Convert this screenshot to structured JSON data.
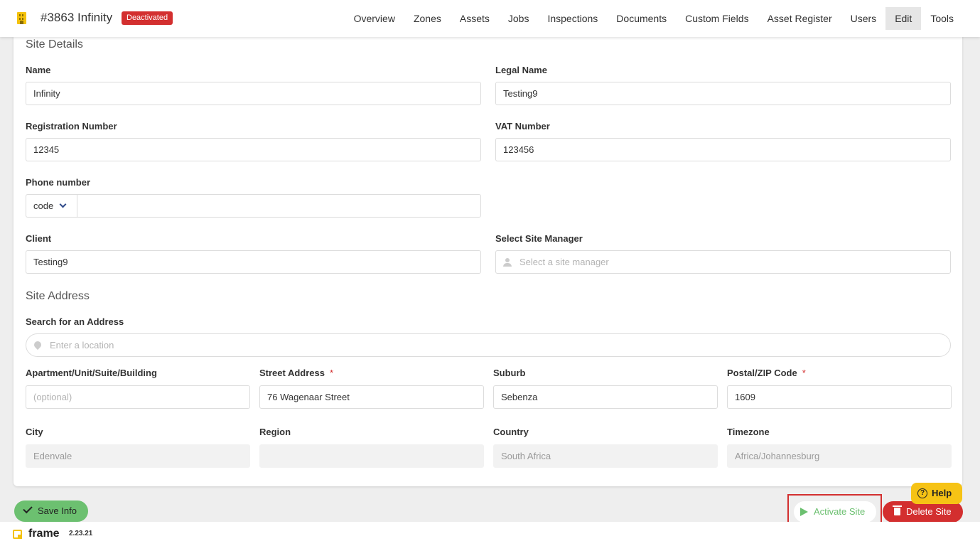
{
  "header": {
    "site_title": "#3863 Infinity",
    "status_badge": "Deactivated",
    "nav": [
      "Overview",
      "Zones",
      "Assets",
      "Jobs",
      "Inspections",
      "Documents",
      "Custom Fields",
      "Asset Register",
      "Users",
      "Edit",
      "Tools"
    ],
    "active_tab": "Edit"
  },
  "site_details": {
    "title": "Site Details",
    "name_label": "Name",
    "name_value": "Infinity",
    "legal_name_label": "Legal Name",
    "legal_name_value": "Testing9",
    "registration_label": "Registration Number",
    "registration_value": "12345",
    "vat_label": "VAT Number",
    "vat_value": "123456",
    "phone_label": "Phone number",
    "phone_code": "code",
    "phone_value": "",
    "client_label": "Client",
    "client_value": "Testing9",
    "manager_label": "Select Site Manager",
    "manager_placeholder": "Select a site manager"
  },
  "site_address": {
    "title": "Site Address",
    "search_label": "Search for an Address",
    "search_placeholder": "Enter a location",
    "apartment_label": "Apartment/Unit/Suite/Building",
    "apartment_placeholder": "(optional)",
    "street_label": "Street Address",
    "street_value": "76 Wagenaar Street",
    "suburb_label": "Suburb",
    "suburb_value": "Sebenza",
    "postal_label": "Postal/ZIP Code",
    "postal_value": "1609",
    "required_mark": "*",
    "city_label": "City",
    "city_value": "Edenvale",
    "region_label": "Region",
    "region_value": "",
    "country_label": "Country",
    "country_value": "South Africa",
    "timezone_label": "Timezone",
    "timezone_value": "Africa/Johannesburg"
  },
  "actions": {
    "save": "Save Info",
    "help": "Help",
    "help_glyph": "?",
    "activate": "Activate Site",
    "delete": "Delete Site"
  },
  "footer": {
    "logo": "frame",
    "version": "2.23.21"
  },
  "colors": {
    "brand_yellow": "#f4c20d",
    "danger": "#d32f2f",
    "success": "#6cc070"
  }
}
